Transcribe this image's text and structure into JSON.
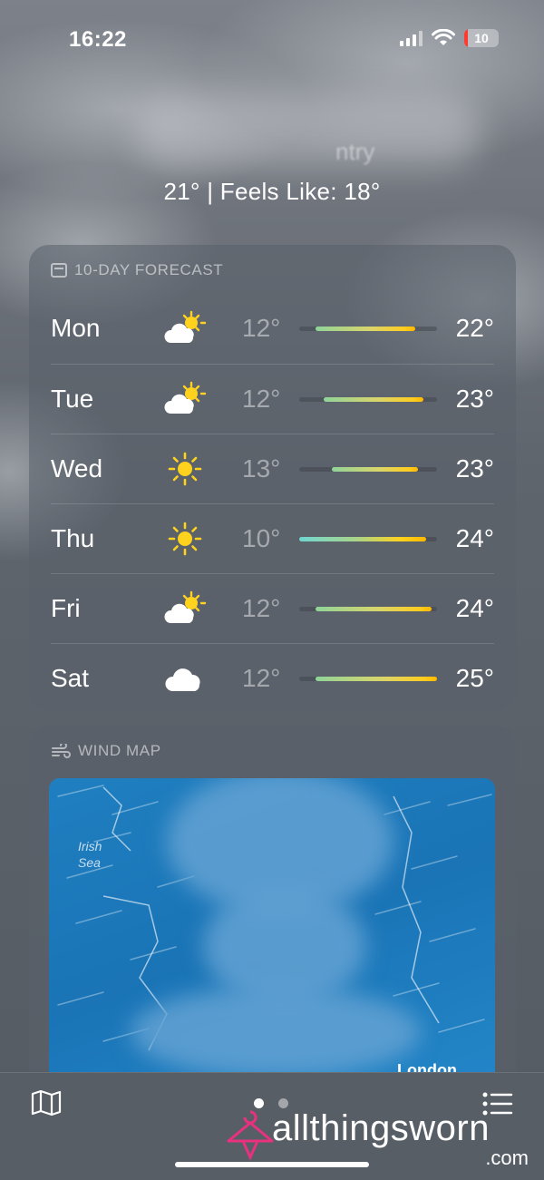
{
  "status_bar": {
    "time": "16:22",
    "battery": "10"
  },
  "header": {
    "location_fragment": "ntry",
    "summary": "21°  |  Feels Like: 18°"
  },
  "forecast": {
    "title": "10-DAY FORECAST",
    "days": [
      {
        "day": "Mon",
        "icon": "partly-sunny-icon",
        "low": "12°",
        "high": "22°",
        "range_start": 0.12,
        "range_end": 0.84
      },
      {
        "day": "Tue",
        "icon": "partly-sunny-icon",
        "low": "12°",
        "high": "23°",
        "range_start": 0.18,
        "range_end": 0.9
      },
      {
        "day": "Wed",
        "icon": "sun-icon",
        "low": "13°",
        "high": "23°",
        "range_start": 0.24,
        "range_end": 0.86
      },
      {
        "day": "Thu",
        "icon": "sun-icon",
        "low": "10°",
        "high": "24°",
        "range_start": 0.0,
        "range_end": 0.92
      },
      {
        "day": "Fri",
        "icon": "partly-sunny-icon",
        "low": "12°",
        "high": "24°",
        "range_start": 0.12,
        "range_end": 0.96
      },
      {
        "day": "Sat",
        "icon": "cloud-icon",
        "low": "12°",
        "high": "25°",
        "range_start": 0.12,
        "range_end": 1.0
      }
    ]
  },
  "wind": {
    "title": "WIND MAP",
    "map_label_1": "Irish",
    "map_label_2": "Sea",
    "map_city": "London"
  },
  "watermark": {
    "text": "allthingsworn",
    "suffix": ".com"
  }
}
